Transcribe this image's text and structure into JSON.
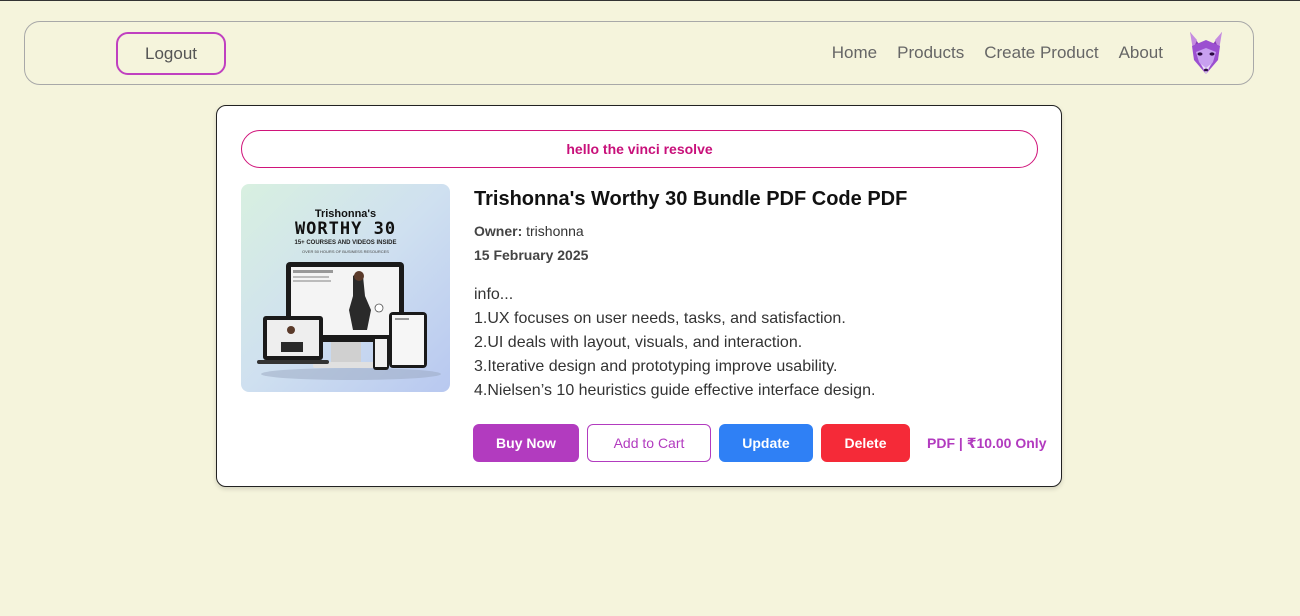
{
  "nav": {
    "logout_label": "Logout",
    "links": [
      "Home",
      "Products",
      "Create Product",
      "About"
    ]
  },
  "card": {
    "banner_text": "hello the vinci resolve",
    "thumbnail": {
      "line1": "Trishonna's",
      "line2": "WORTHY 30",
      "line3": "15+ COURSES AND VIDEOS INSIDE",
      "line4": "OVER 50 HOURS OF BUSINESS RESOURCES"
    },
    "title": "Trishonna's Worthy 30 Bundle PDF Code PDF",
    "owner_label": "Owner:",
    "owner_name": "trishonna",
    "date": "15 February 2025",
    "description": [
      "info...",
      "1.UX focuses on user needs, tasks, and satisfaction.",
      "2.UI deals with layout, visuals, and interaction.",
      "3.Iterative design and prototyping improve usability.",
      "4.Nielsen’s 10 heuristics guide effective interface design."
    ],
    "buttons": {
      "buy": "Buy Now",
      "cart": "Add to Cart",
      "update": "Update",
      "delete": "Delete"
    },
    "price": "PDF | ₹10.00 Only"
  },
  "colors": {
    "background": "#f5f4dc",
    "accent_purple": "#b23bbf",
    "banner_pink": "#c8107a",
    "update_blue": "#2f80f5",
    "delete_red": "#f52a38"
  },
  "icons": {
    "logo": "fox-logo-icon"
  }
}
